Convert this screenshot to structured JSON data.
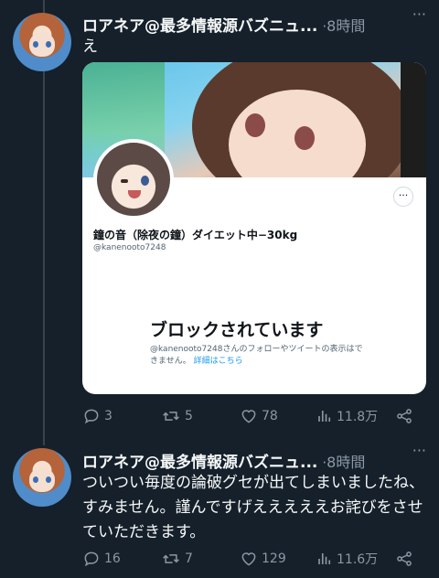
{
  "tweets": [
    {
      "author": "ロアネア@最多情報源バズニュ...",
      "sep": "·",
      "time": "8時間",
      "more": "···",
      "text": "え",
      "card": {
        "profile_name": "鐘の音（除夜の鐘）ダイエット中−30kg",
        "handle": "@kanenooto7248",
        "more": "···",
        "blocked_title": "ブロックされています",
        "blocked_desc": "@kanenooto7248さんのフォローやツイートの表示はできません。",
        "blocked_link": "詳細はこちら"
      },
      "stats": {
        "replies": "3",
        "retweets": "5",
        "likes": "78",
        "views": "11.8万"
      }
    },
    {
      "author": "ロアネア@最多情報源バズニュ...",
      "sep": "·",
      "time": "8時間",
      "more": "···",
      "text": "ついつい毎度の論破グセが出てしまいましたね、すみません。謹んですげえええええお詫びをさせていただきます。",
      "stats": {
        "replies": "16",
        "retweets": "7",
        "likes": "129",
        "views": "11.6万"
      }
    }
  ],
  "icons": [
    "reply-icon",
    "retweet-icon",
    "like-icon",
    "views-icon",
    "share-icon",
    "more-icon"
  ]
}
